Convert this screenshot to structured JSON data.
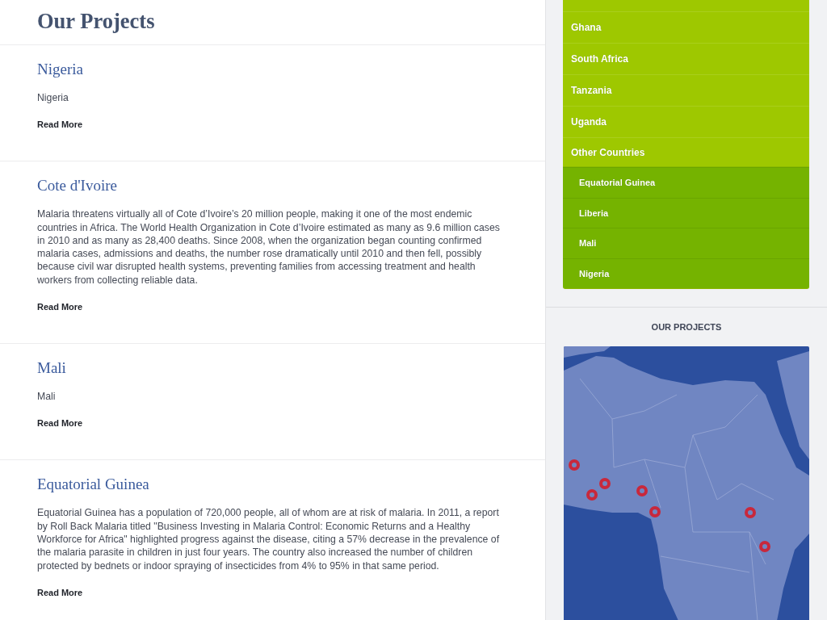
{
  "page_title": "Our Projects",
  "projects": [
    {
      "title": "Nigeria",
      "summary": "Nigeria",
      "link": "Read More"
    },
    {
      "title": "Cote d'Ivoire",
      "summary": "Malaria threatens virtually all of Cote d’Ivoire’s 20 million people, making it one of the most endemic countries in Africa. The World Health Organization in Cote d’Ivoire estimated as many as 9.6 million cases in 2010 and as many as 28,400 deaths. Since 2008, when the organization began counting confirmed malaria cases, admissions and deaths, the number rose dramatically until 2010 and then fell, possibly because civil war disrupted health systems, preventing families from accessing treatment and health workers from collecting reliable data.",
      "link": "Read More"
    },
    {
      "title": "Mali",
      "summary": "Mali",
      "link": "Read More"
    },
    {
      "title": "Equatorial Guinea",
      "summary": "Equatorial Guinea has a population of 720,000 people, all of whom are at risk of malaria. In 2011, a report by Roll Back Malaria titled \"Business Investing in Malaria Control: Economic Returns and a Healthy Workforce for Africa\" highlighted progress against the disease, citing a 57% decrease in the prevalence of the malaria parasite in children in just four years. The country also increased the number of children protected by bednets or indoor spraying of insecticides from 4% to 95% in that same period.",
      "link": "Read More"
    }
  ],
  "sidebar": {
    "menu": [
      {
        "label": "Ghana"
      },
      {
        "label": "South Africa"
      },
      {
        "label": "Tanzania"
      },
      {
        "label": "Uganda"
      },
      {
        "label": "Other Countries",
        "expanded": true,
        "children": [
          {
            "label": "Equatorial Guinea"
          },
          {
            "label": "Liberia"
          },
          {
            "label": "Mali"
          },
          {
            "label": "Nigeria"
          }
        ]
      }
    ],
    "map_widget": {
      "title": "OUR PROJECTS"
    }
  }
}
